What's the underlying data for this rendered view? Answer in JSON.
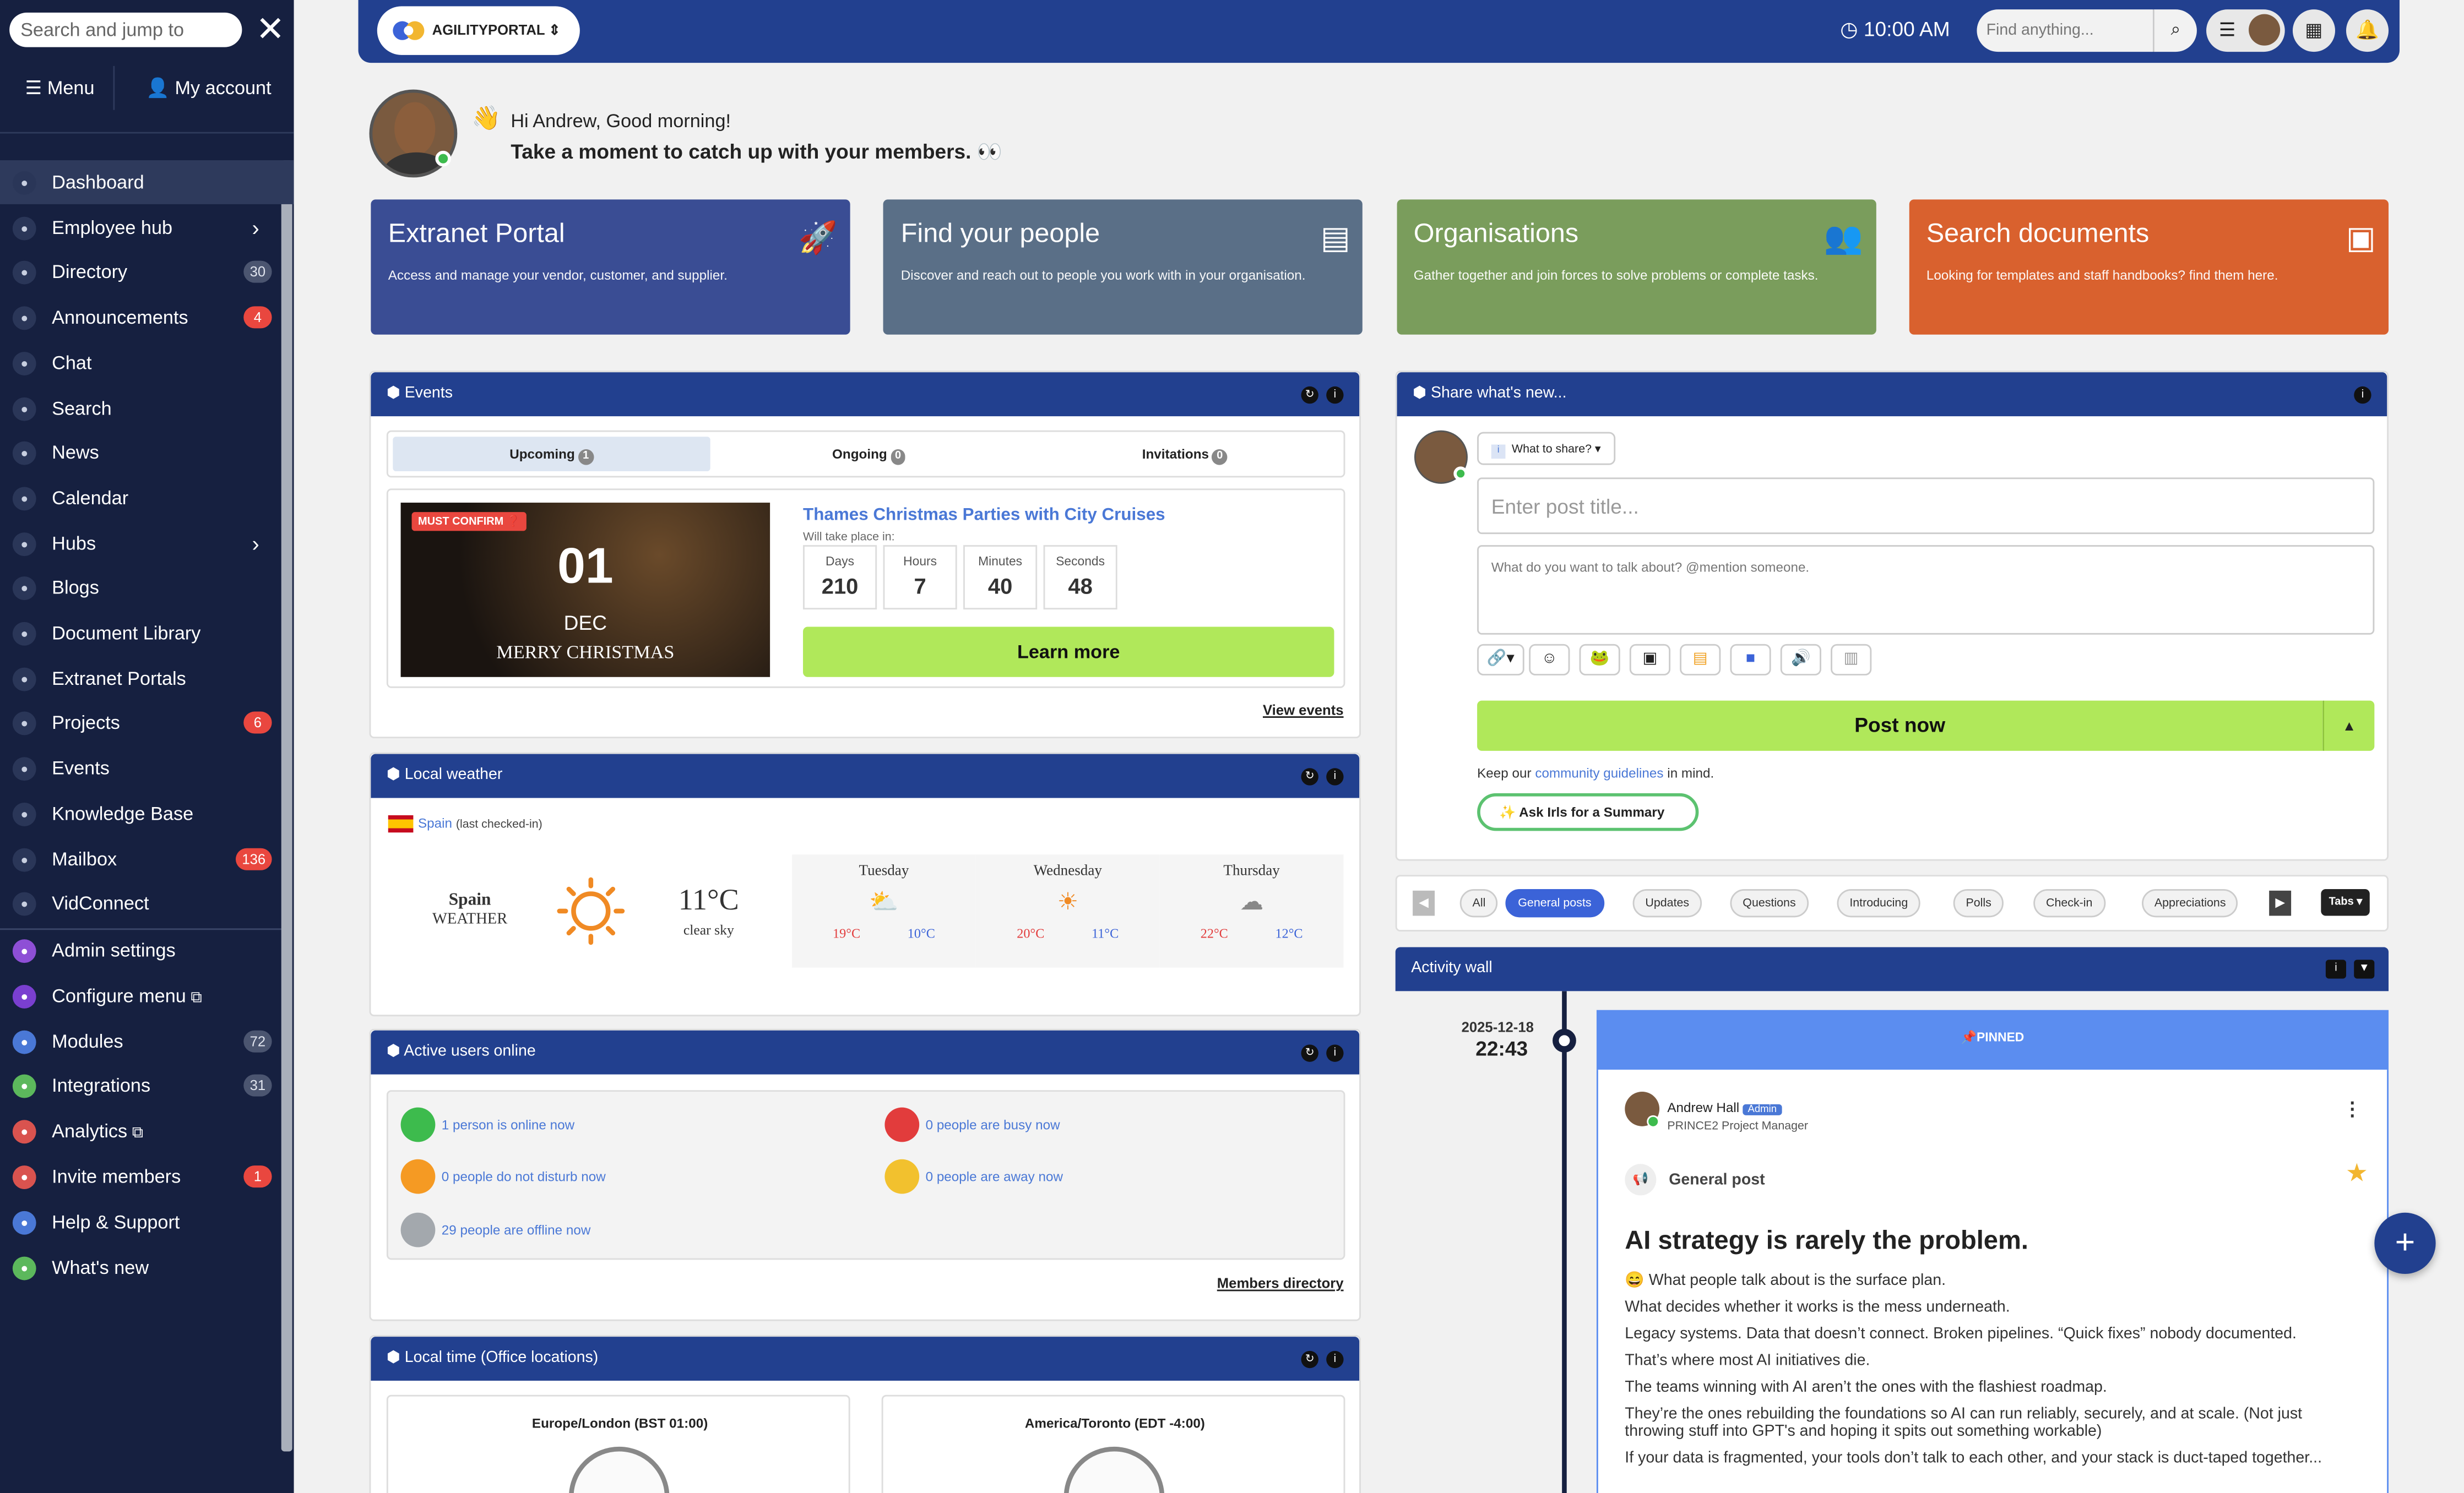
{
  "sidebar": {
    "search_placeholder": "Search and jump to",
    "menu_label": "Menu",
    "account_label": "My account",
    "items": [
      {
        "label": "Dashboard",
        "icon": "dashboard-icon"
      },
      {
        "label": "Employee hub",
        "icon": "users-icon"
      },
      {
        "label": "Directory",
        "icon": "directory-icon",
        "badge": "30"
      },
      {
        "label": "Announcements",
        "icon": "megaphone-icon",
        "badge": "4"
      },
      {
        "label": "Chat",
        "icon": "chat-icon"
      },
      {
        "label": "Search",
        "icon": "search-icon"
      },
      {
        "label": "News",
        "icon": "news-icon"
      },
      {
        "label": "Calendar",
        "icon": "calendar-icon"
      },
      {
        "label": "Hubs",
        "icon": "hubs-icon"
      },
      {
        "label": "Blogs",
        "icon": "blogs-icon"
      },
      {
        "label": "Document Library",
        "icon": "document-icon"
      },
      {
        "label": "Extranet Portals",
        "icon": "portal-icon"
      },
      {
        "label": "Projects",
        "icon": "projects-icon",
        "badge": "6"
      },
      {
        "label": "Events",
        "icon": "events-icon"
      },
      {
        "label": "Knowledge Base",
        "icon": "knowledge-icon"
      },
      {
        "label": "Mailbox",
        "icon": "mailbox-icon",
        "badge": "136"
      },
      {
        "label": "VidConnect",
        "icon": "video-icon"
      }
    ],
    "admin_items": [
      {
        "label": "Admin settings",
        "color": "#8e4fd6",
        "badge": ""
      },
      {
        "label": "Configure menu",
        "color": "#7a3fd0",
        "badge": ""
      },
      {
        "label": "Modules",
        "color": "#4a78d6",
        "badge": "72"
      },
      {
        "label": "Integrations",
        "color": "#5cb85c",
        "badge": "31"
      },
      {
        "label": "Analytics",
        "color": "#d9534f",
        "badge": ""
      },
      {
        "label": "Invite members",
        "color": "#d9534f",
        "badge": "1"
      },
      {
        "label": "Help & Support",
        "color": "#4a78d6",
        "badge": ""
      },
      {
        "label": "What's new",
        "color": "#5cb85c",
        "badge": ""
      }
    ]
  },
  "topbar": {
    "logo_text": "AGILITYPORTAL",
    "time": "10:00 AM",
    "search_placeholder": "Find anything..."
  },
  "greeting": {
    "line1": "Hi Andrew, Good morning!",
    "line2": "Take a moment to catch up with your members."
  },
  "quick_cards": [
    {
      "title": "Extranet Portal",
      "desc": "Access and manage your vendor, customer, and supplier.",
      "color": "#3a4d94",
      "icon": "rocket-icon"
    },
    {
      "title": "Find your people",
      "desc": "Discover and reach out to people you work with in your organisation.",
      "color": "#5a6f87",
      "icon": "contact-card-icon"
    },
    {
      "title": "Organisations",
      "desc": "Gather together and join forces to solve problems or complete tasks.",
      "color": "#7a9d5c",
      "icon": "group-icon"
    },
    {
      "title": "Search documents",
      "desc": "Looking for templates and staff handbooks? find them here.",
      "color": "#d9612e",
      "icon": "folder-plus-icon"
    }
  ],
  "events": {
    "title": "Events",
    "tabs": [
      {
        "label": "Upcoming",
        "count": "1"
      },
      {
        "label": "Ongoing",
        "count": "0"
      },
      {
        "label": "Invitations",
        "count": "0"
      }
    ],
    "badge": "MUST CONFIRM",
    "day": "01",
    "month": "DEC",
    "image_text": "MERRY CHRISTMAS",
    "event_title": "Thames Christmas Parties with City Cruises",
    "subtitle": "Will take place in:",
    "countdown": [
      {
        "label": "Days",
        "value": "210"
      },
      {
        "label": "Hours",
        "value": "7"
      },
      {
        "label": "Minutes",
        "value": "40"
      },
      {
        "label": "Seconds",
        "value": "48"
      }
    ],
    "learn_more": "Learn more",
    "view_events": "View events"
  },
  "weather": {
    "title": "Local weather",
    "location_link": "Spain",
    "location_note": "(last checked-in)",
    "city": "Spain",
    "city_sub": "WEATHER",
    "temp": "11°C",
    "condition": "clear sky",
    "days": [
      {
        "name": "Tuesday",
        "high": "19°C",
        "low": "10°C",
        "icon": "partly-sunny-icon"
      },
      {
        "name": "Wednesday",
        "high": "20°C",
        "low": "11°C",
        "icon": "sun-icon"
      },
      {
        "name": "Thursday",
        "high": "22°C",
        "low": "12°C",
        "icon": "cloud-icon"
      }
    ]
  },
  "users": {
    "title": "Active users online",
    "online": "1 person is online now",
    "busy": "0 people are busy now",
    "dnd": "0 people do not disturb now",
    "away": "0 people are away now",
    "offline": "29 people are offline now",
    "directory_link": "Members directory"
  },
  "localtime": {
    "title": "Local time (Office locations)",
    "zone1": "Europe/London (BST 01:00)",
    "zone2": "America/Toronto (EDT -4:00)"
  },
  "share": {
    "title": "Share what's new...",
    "what_to_share": "What to share?",
    "title_placeholder": "Enter post title...",
    "body_placeholder": "What do you want to talk about? @mention someone.",
    "post_now": "Post now",
    "guideline_pre": "Keep our",
    "guideline_link": "community guidelines",
    "guideline_post": "in mind.",
    "ask_irls": "Ask Irls for a Summary"
  },
  "filters": {
    "items": [
      "All",
      "General posts",
      "Updates",
      "Questions",
      "Introducing",
      "Polls",
      "Check-in",
      "Appreciations"
    ],
    "active": "General posts",
    "tabs_label": "Tabs"
  },
  "activity": {
    "title": "Activity wall",
    "date": "2025-12-18",
    "time": "22:43",
    "pinned": "PINNED",
    "author": "Andrew Hall",
    "author_badge": "Admin",
    "author_role": "PRINCE2 Project Manager",
    "post_type": "General post",
    "heading": "AI strategy is rarely the problem.",
    "lines": [
      "What people talk about is the surface plan.",
      "What decides whether it works is the mess underneath.",
      "Legacy systems. Data that doesn’t connect. Broken pipelines. “Quick fixes” nobody documented.",
      "That’s where most AI initiatives die.",
      "The teams winning with AI aren’t the ones with the flashiest roadmap.",
      "They’re the ones rebuilding the foundations so AI can run reliably, securely, and at scale. (Not just throwing stuff into GPT's and hoping it spits out something workable)",
      "If your data is fragmented, your tools don’t talk to each other, and your stack is duct-taped together..."
    ]
  }
}
